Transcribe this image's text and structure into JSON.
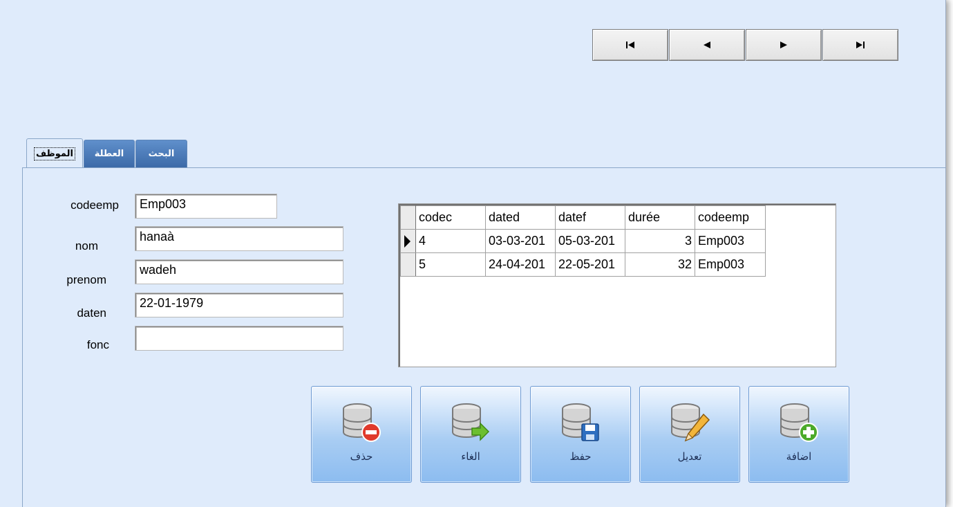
{
  "navigator": {
    "first_icon": "first-record-icon",
    "prev_icon": "previous-record-icon",
    "next_icon": "next-record-icon",
    "last_icon": "last-record-icon"
  },
  "tabs": [
    {
      "label": "الموظف",
      "active": true
    },
    {
      "label": "العطلة",
      "active": false
    },
    {
      "label": "البحث",
      "active": false
    }
  ],
  "form": {
    "codeemp": {
      "label": "codeemp",
      "value": "Emp003"
    },
    "nom": {
      "label": "nom",
      "value": "hanaà"
    },
    "prenom": {
      "label": "prenom",
      "value": "wadeh"
    },
    "daten": {
      "label": "daten",
      "value": "22-01-1979"
    },
    "fonc": {
      "label": "fonc",
      "value": ""
    }
  },
  "grid": {
    "columns": [
      "codec",
      "dated",
      "datef",
      "durée",
      "codeemp"
    ],
    "rows": [
      [
        "4",
        "03-03-201",
        "05-03-201",
        "3",
        "Emp003"
      ],
      [
        "5",
        "24-04-201",
        "22-05-201",
        "32",
        "Emp003"
      ]
    ]
  },
  "actions": {
    "delete": {
      "label": "حذف",
      "icon": "database-delete-icon"
    },
    "cancel": {
      "label": "الغاء",
      "icon": "database-cancel-icon"
    },
    "save": {
      "label": "حفظ",
      "icon": "database-save-icon"
    },
    "edit": {
      "label": "تعديل",
      "icon": "database-edit-icon"
    },
    "add": {
      "label": "اضافة",
      "icon": "database-add-icon"
    }
  },
  "colors": {
    "window_bg": "#dfebfb",
    "tab_inactive": "#4a7ab8",
    "button_gradient_bottom": "#8cbcf0"
  }
}
